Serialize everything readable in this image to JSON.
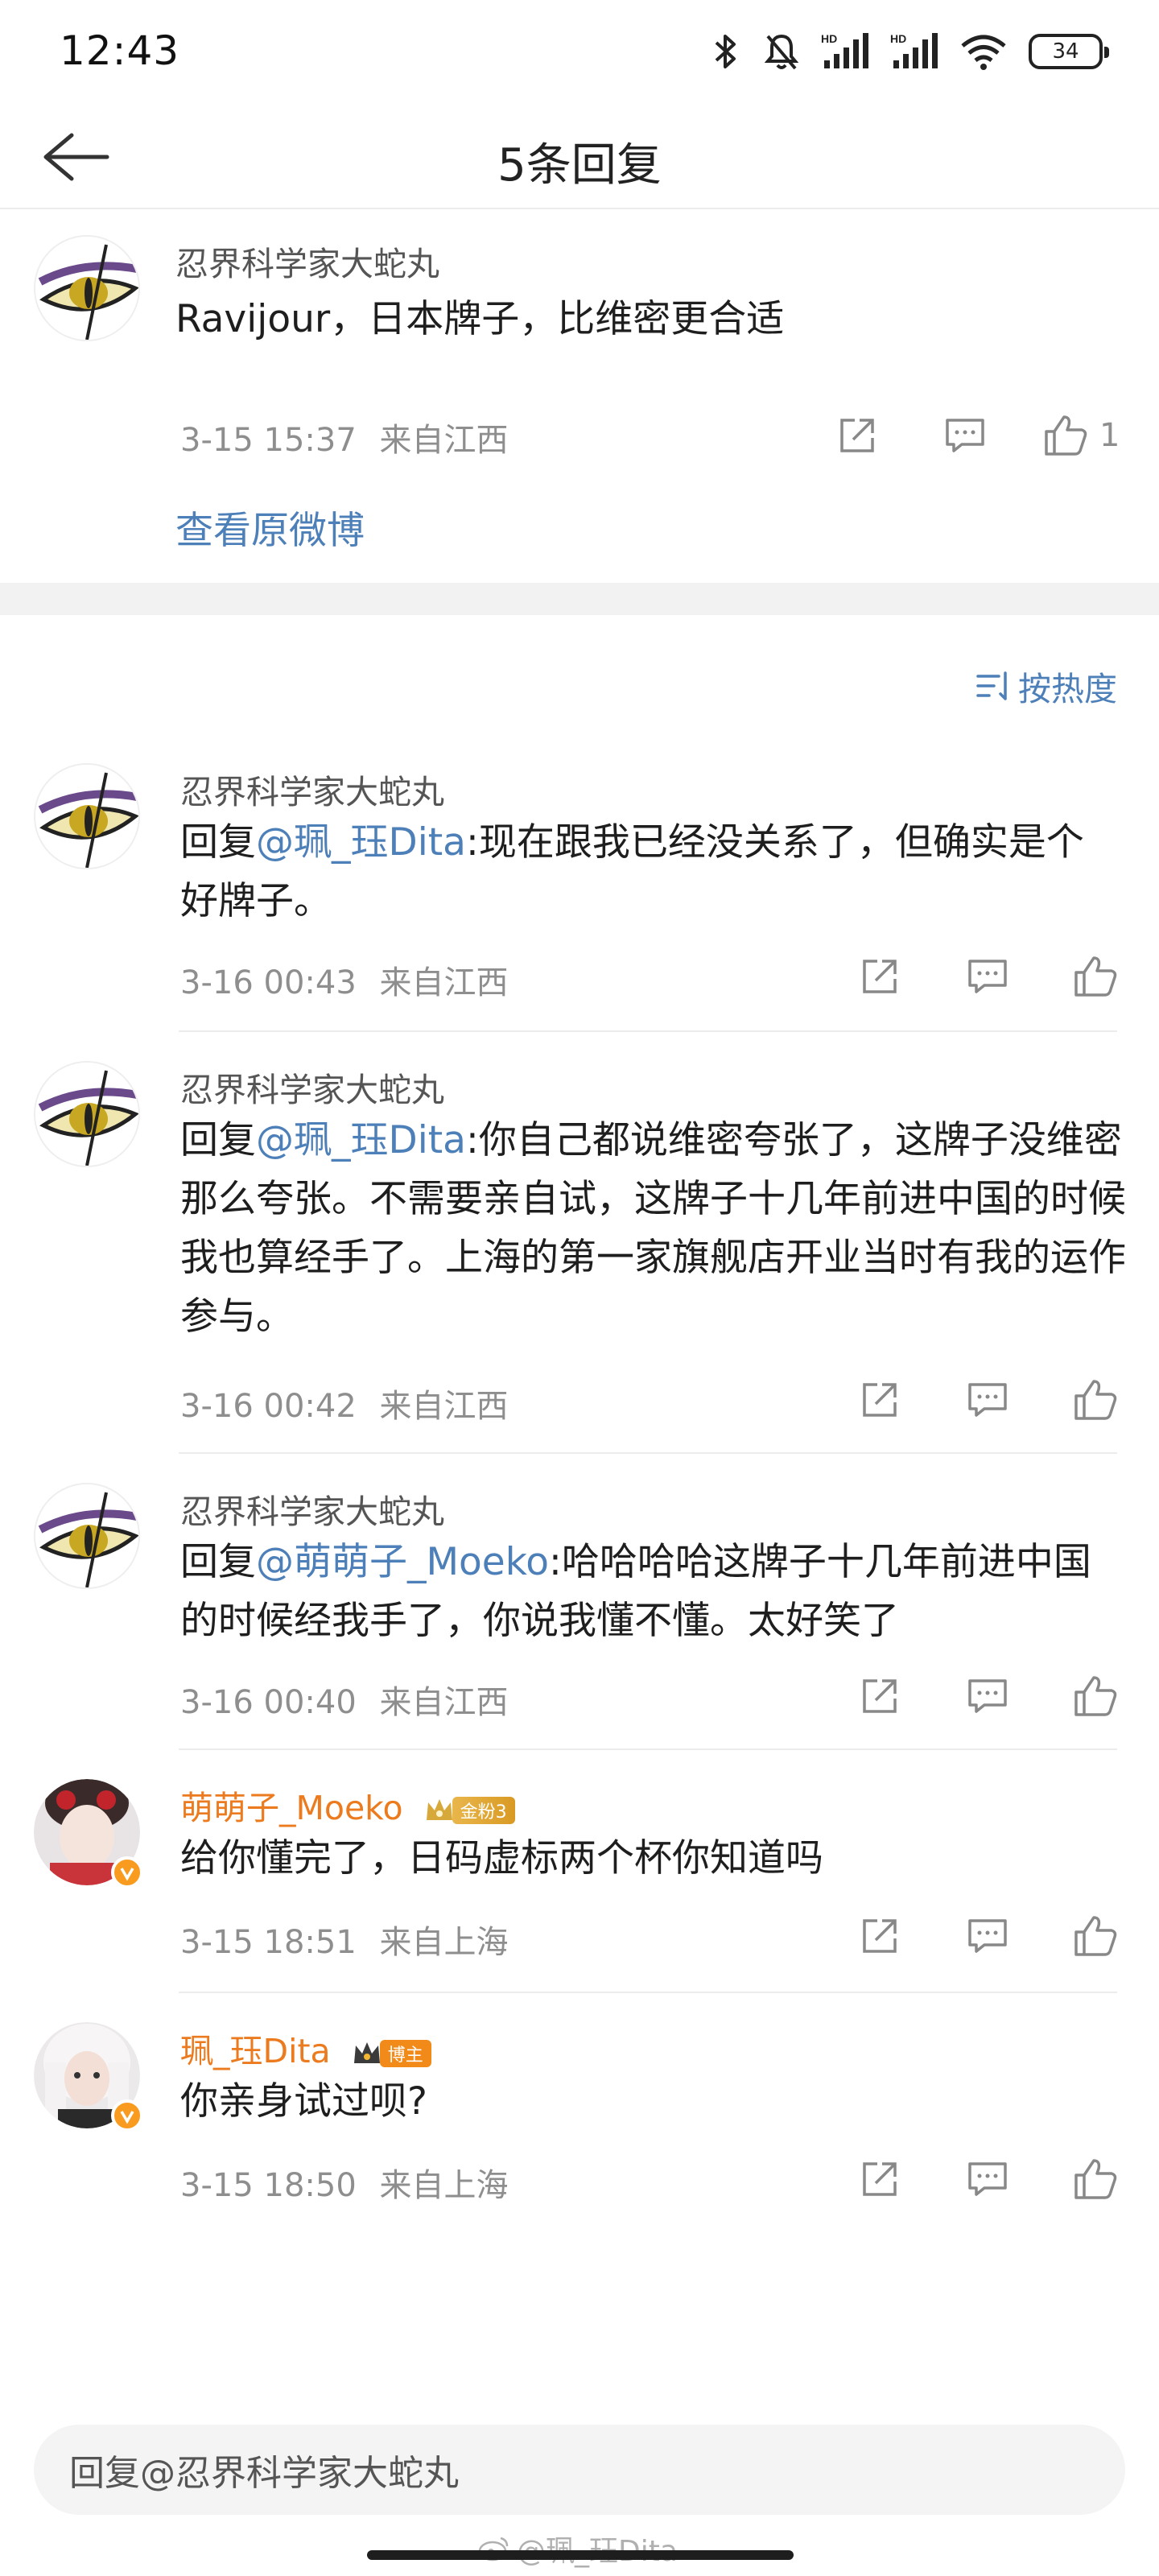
{
  "status_bar": {
    "time": "12:43",
    "battery": "34"
  },
  "header": {
    "title": "5条回复"
  },
  "root_comment": {
    "user": "忍界科学家大蛇丸",
    "text": "Ravijour，日本牌子，比维密更合适",
    "time": "3-15 15:37",
    "location": "来自江西",
    "likes": "1",
    "view_original": "查看原微博"
  },
  "sort": {
    "label": "按热度"
  },
  "replies": [
    {
      "user": "忍界科学家大蛇丸",
      "reply_prefix": "回复",
      "mention": "@珮_珏Dita",
      "text": ":现在跟我已经没关系了，但确实是个好牌子。",
      "time": "3-16 00:43",
      "location": "来自江西"
    },
    {
      "user": "忍界科学家大蛇丸",
      "reply_prefix": "回复",
      "mention": "@珮_珏Dita",
      "text": ":你自己都说维密夸张了，这牌子没维密那么夸张。不需要亲自试，这牌子十几年前进中国的时候我也算经手了。上海的第一家旗舰店开业当时有我的运作参与。",
      "time": "3-16 00:42",
      "location": "来自江西"
    },
    {
      "user": "忍界科学家大蛇丸",
      "reply_prefix": "回复",
      "mention": "@萌萌子_Moeko",
      "text": ":哈哈哈哈这牌子十几年前进中国的时候经我手了，你说我懂不懂。太好笑了",
      "time": "3-16 00:40",
      "location": "来自江西"
    },
    {
      "user": "萌萌子_Moeko",
      "badge": "金粉3",
      "text": "给你懂完了，日码虚标两个杯你知道吗",
      "time": "3-15 18:51",
      "location": "来自上海"
    },
    {
      "user": "珮_珏Dita",
      "badge": "博主",
      "text": "你亲身试过呗?",
      "time": "3-15 18:50",
      "location": "来自上海"
    }
  ],
  "input": {
    "placeholder": "回复@忍界科学家大蛇丸"
  },
  "watermark": "@珮_珏Dita",
  "colors": {
    "link": "#4d7fb8",
    "username_vip": "#eb7b1e",
    "separator": "#f2f2f2"
  },
  "icons": [
    "bluetooth-icon",
    "mute-bell-icon",
    "hd-signal-icon",
    "wifi-icon",
    "battery-icon",
    "back-arrow-icon",
    "share-icon",
    "comment-icon",
    "like-icon",
    "sort-icon",
    "crown-icon",
    "verified-icon"
  ]
}
